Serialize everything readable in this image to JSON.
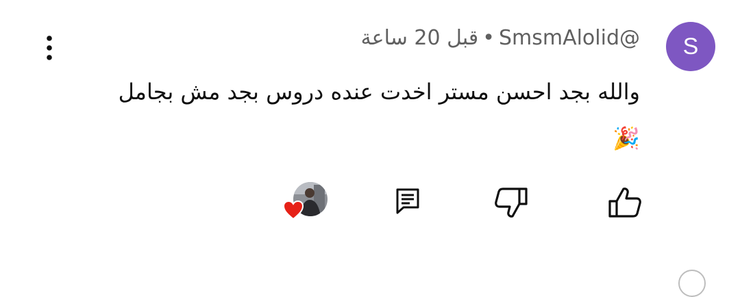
{
  "comment": {
    "author_initial": "S",
    "author_handle": "@SmsmAlolid",
    "separator": "•",
    "timestamp": "قبل 20 ساعة",
    "text": "والله بجد احسن مستر اخدت عنده دروس بجد مش بجامل🎉",
    "avatar_color": "#7e57c2"
  },
  "actions": {
    "like_icon": "thumb-up-icon",
    "dislike_icon": "thumb-down-icon",
    "reply_icon": "comment-icon",
    "menu_icon": "more-vert-icon",
    "creator_heart_icon": "heart-icon",
    "heart_color": "#e62117"
  }
}
